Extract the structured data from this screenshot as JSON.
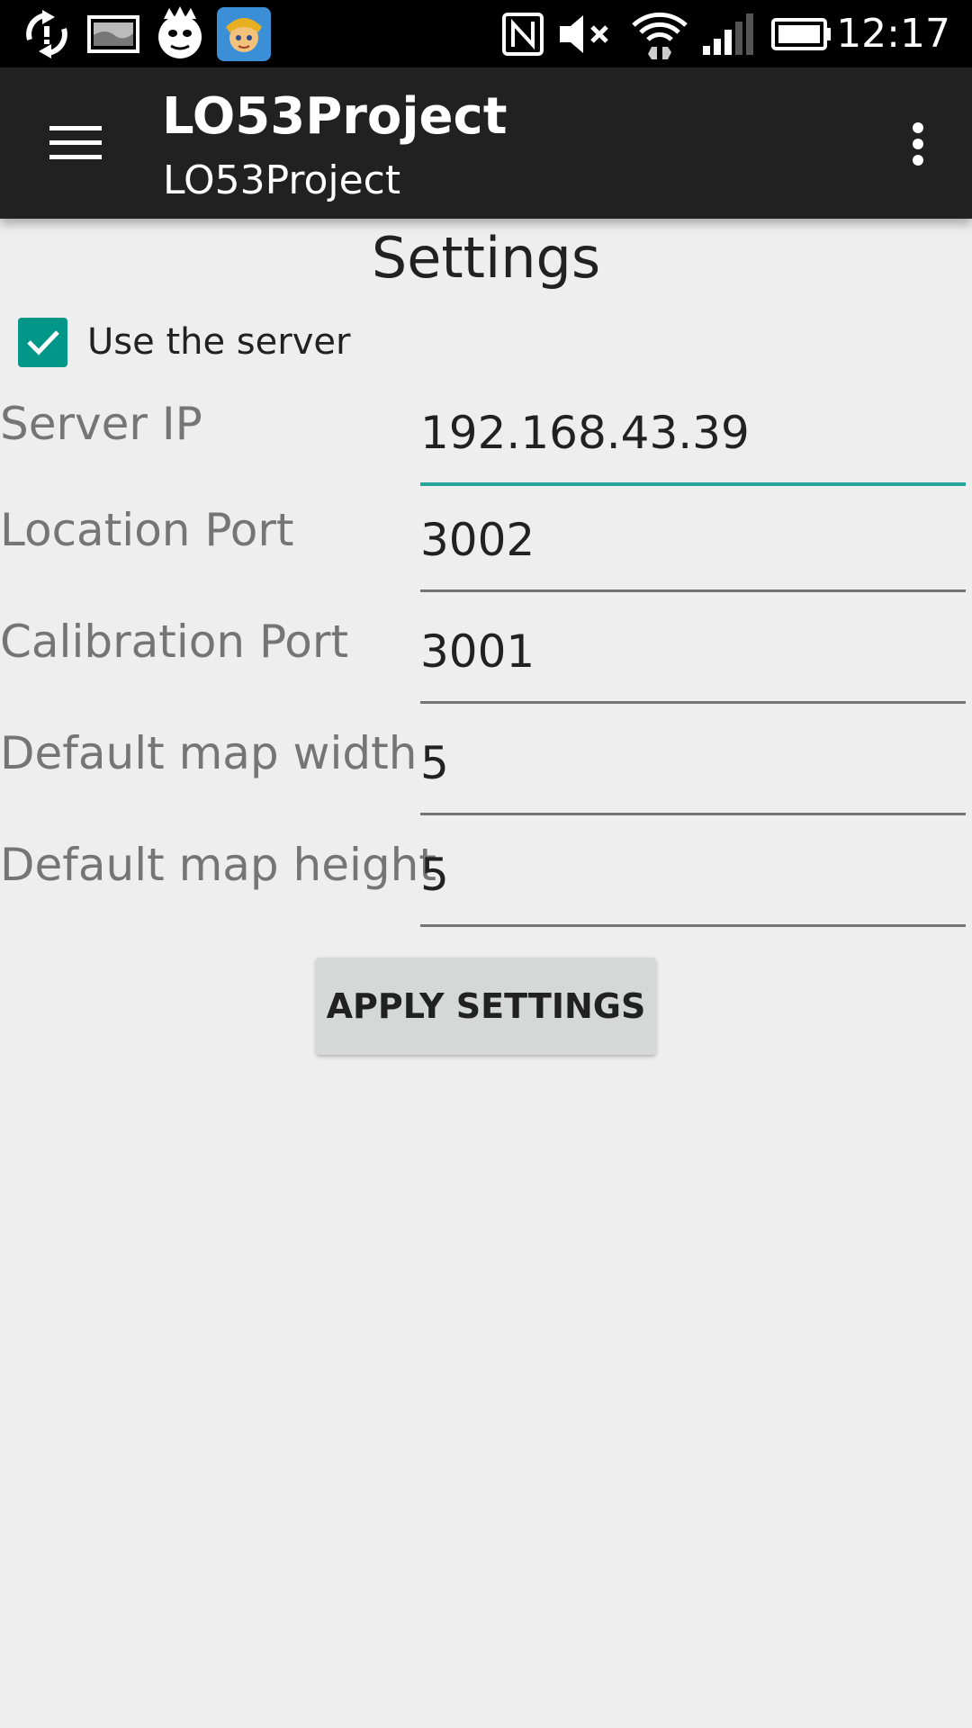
{
  "status_bar": {
    "time": "12:17",
    "left_icons": [
      "sync-icon",
      "gallery-icon",
      "ghost-app-icon",
      "game-app-icon"
    ],
    "right_icons": [
      "nfc-icon",
      "mute-icon",
      "wifi-icon",
      "signal-icon",
      "battery-icon"
    ]
  },
  "app_bar": {
    "title": "LO53Project",
    "subtitle": "LO53Project"
  },
  "settings": {
    "title": "Settings",
    "use_server": {
      "label": "Use the server",
      "checked": true
    },
    "fields": [
      {
        "label": "Server IP",
        "value": "192.168.43.39"
      },
      {
        "label": "Location Port",
        "value": "3002"
      },
      {
        "label": "Calibration Port",
        "value": "3001"
      },
      {
        "label": "Default map width",
        "value": "5"
      },
      {
        "label": "Default map height",
        "value": "5"
      }
    ],
    "apply_label": "APPLY SETTINGS"
  },
  "colors": {
    "accent": "#009688",
    "app_bar": "#212121",
    "background": "#eeeeee"
  }
}
